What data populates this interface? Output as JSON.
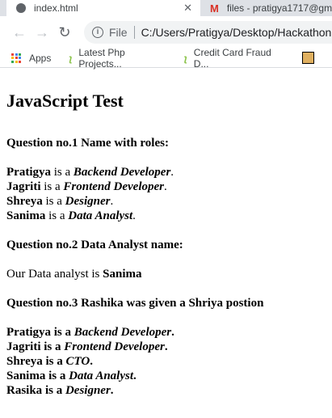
{
  "browser": {
    "tabs": [
      {
        "title": "index.html",
        "active": true
      },
      {
        "title": "files - pratigya1717@gm",
        "active": false
      }
    ],
    "address": {
      "scheme_label": "File",
      "url": "C:/Users/Pratigya/Desktop/Hackathon"
    },
    "bookmarks": [
      {
        "label": "Apps",
        "icon": "apps-grid-icon"
      },
      {
        "label": "Latest Php Projects...",
        "icon": "leaf-icon"
      },
      {
        "label": "Credit Card Fraud D...",
        "icon": "leaf-icon"
      }
    ]
  },
  "page": {
    "title": "JavaScript Test",
    "q1": {
      "heading": "Question no.1 Name with roles:",
      "lines": [
        {
          "name": "Pratigya",
          "mid": " is a ",
          "role": "Backend Developer",
          "end": "."
        },
        {
          "name": "Jagriti",
          "mid": " is a ",
          "role": "Frontend Developer",
          "end": "."
        },
        {
          "name": "Shreya",
          "mid": " is a ",
          "role": "Designer",
          "end": "."
        },
        {
          "name": "Sanima",
          "mid": " is a ",
          "role": "Data Analyst",
          "end": "."
        }
      ]
    },
    "q2": {
      "heading": "Question no.2 Data Analyst name:",
      "text": "Our Data analyst is ",
      "name": "Sanima"
    },
    "q3": {
      "heading": "Question no.3 Rashika was given a Shriya postion",
      "lines": [
        {
          "name": "Pratigya",
          "mid": " is a ",
          "role": "Backend Developer",
          "end": "."
        },
        {
          "name": "Jagriti",
          "mid": " is a ",
          "role": "Frontend Developer",
          "end": "."
        },
        {
          "name": "Shreya",
          "mid": " is a ",
          "role": "CTO",
          "end": "."
        },
        {
          "name": "Sanima",
          "mid": " is a ",
          "role": "Data Analyst",
          "end": "."
        },
        {
          "name": "Rasika",
          "mid": " is a ",
          "role": "Designer",
          "end": "."
        }
      ]
    }
  }
}
